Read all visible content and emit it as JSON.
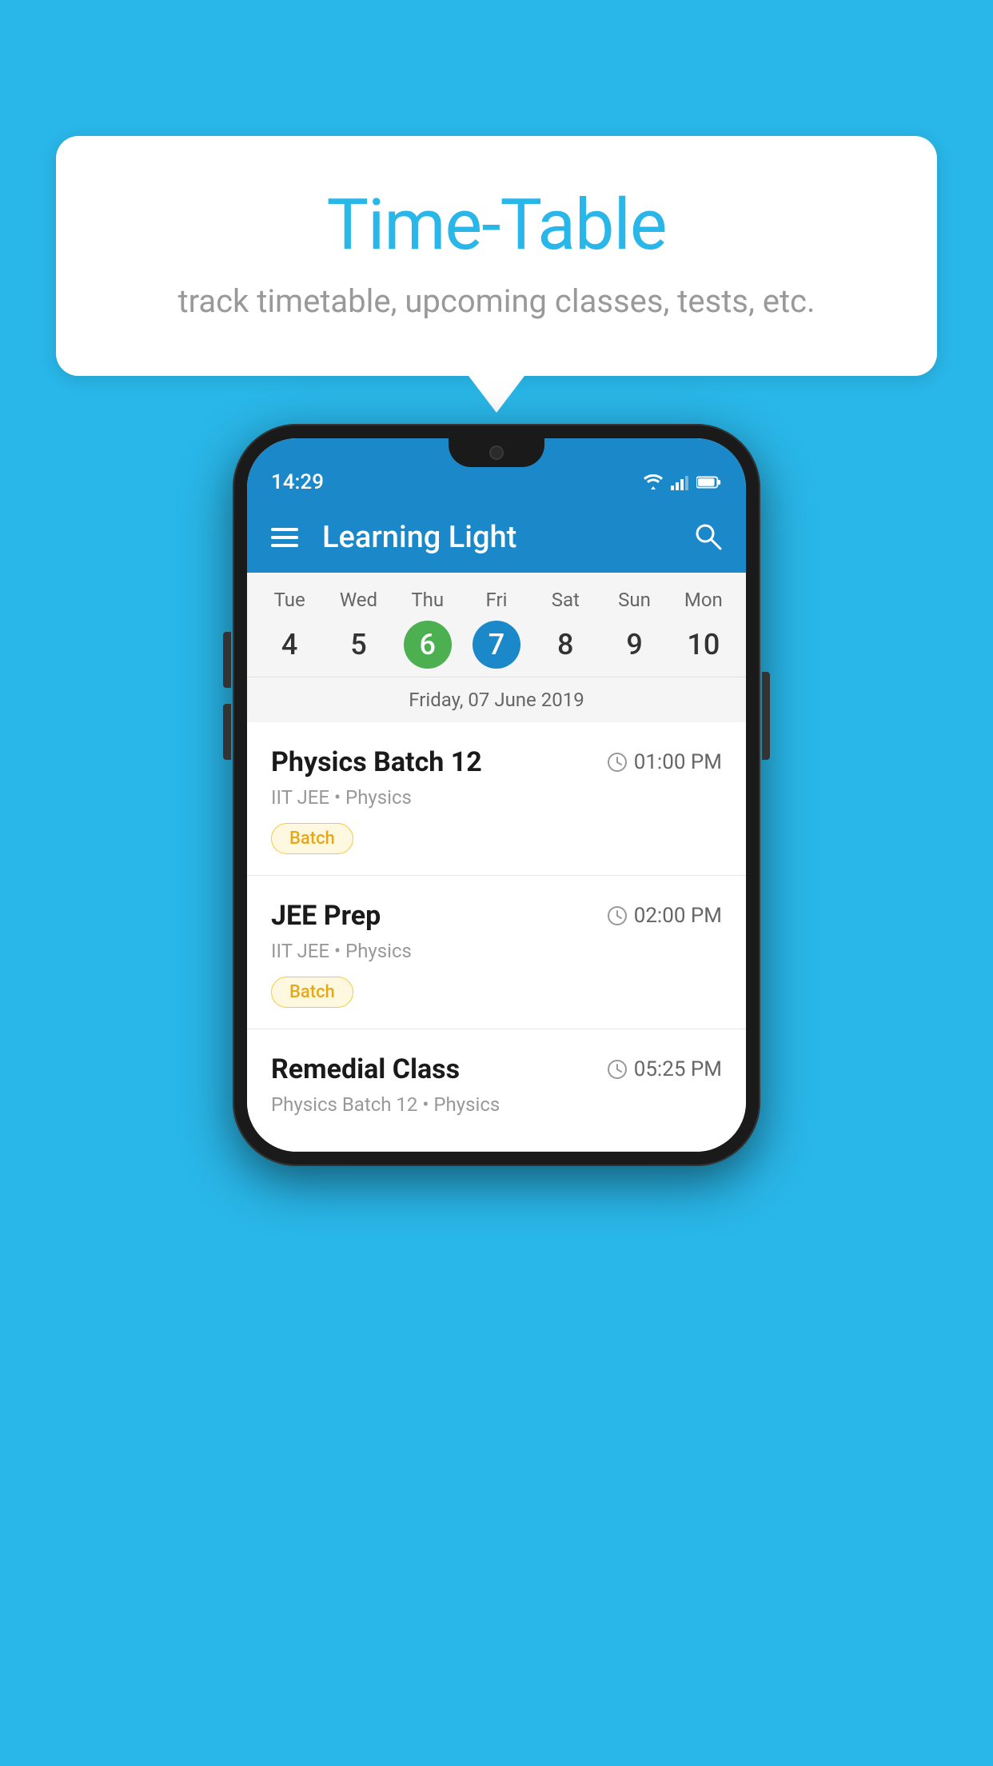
{
  "background_color": "#29b6e8",
  "speech_bubble": {
    "title": "Time-Table",
    "subtitle": "track timetable, upcoming classes, tests, etc."
  },
  "phone": {
    "status_bar": {
      "time": "14:29"
    },
    "app_bar": {
      "title": "Learning Light"
    },
    "calendar": {
      "days": [
        {
          "name": "Tue",
          "num": "4",
          "state": "normal"
        },
        {
          "name": "Wed",
          "num": "5",
          "state": "normal"
        },
        {
          "name": "Thu",
          "num": "6",
          "state": "today"
        },
        {
          "name": "Fri",
          "num": "7",
          "state": "selected"
        },
        {
          "name": "Sat",
          "num": "8",
          "state": "normal"
        },
        {
          "name": "Sun",
          "num": "9",
          "state": "normal"
        },
        {
          "name": "Mon",
          "num": "10",
          "state": "normal"
        }
      ],
      "selected_date_label": "Friday, 07 June 2019"
    },
    "schedule": {
      "items": [
        {
          "name": "Physics Batch 12",
          "time": "01:00 PM",
          "meta": "IIT JEE • Physics",
          "badge": "Batch"
        },
        {
          "name": "JEE Prep",
          "time": "02:00 PM",
          "meta": "IIT JEE • Physics",
          "badge": "Batch"
        },
        {
          "name": "Remedial Class",
          "time": "05:25 PM",
          "meta": "Physics Batch 12 • Physics",
          "badge": null
        }
      ]
    }
  }
}
